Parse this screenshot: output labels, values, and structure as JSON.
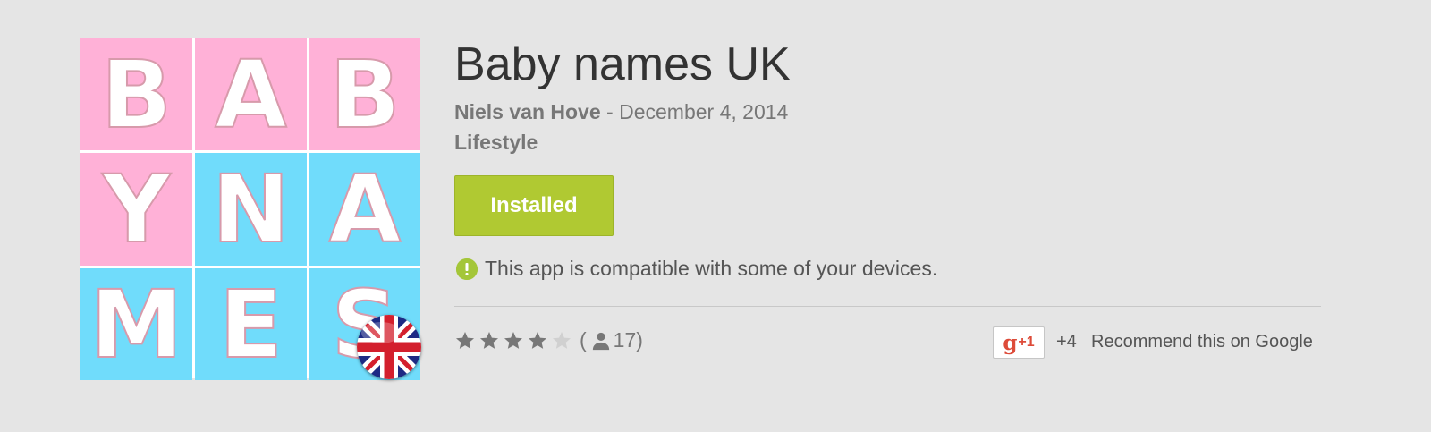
{
  "app_icon": {
    "tiles": [
      {
        "letter": "B",
        "color": "#ffb1d7"
      },
      {
        "letter": "A",
        "color": "#ffb1d7"
      },
      {
        "letter": "B",
        "color": "#ffb1d7"
      },
      {
        "letter": "Y",
        "color": "#ffb1d7"
      },
      {
        "letter": "N",
        "color": "#70dcfb"
      },
      {
        "letter": "A",
        "color": "#70dcfb"
      },
      {
        "letter": "M",
        "color": "#70dcfb"
      },
      {
        "letter": "E",
        "color": "#70dcfb"
      },
      {
        "letter": "S",
        "color": "#70dcfb"
      }
    ],
    "badge_icon": "uk-flag-icon"
  },
  "app": {
    "title": "Baby names UK",
    "developer": "Niels van Hove",
    "separator": " - ",
    "date": "December 4, 2014",
    "category": "Lifestyle"
  },
  "install_button": {
    "label": "Installed",
    "color": "#b0c932"
  },
  "compatibility": {
    "icon": "info-icon",
    "text": "This app is compatible with some of your devices."
  },
  "rating": {
    "stars_filled": 4,
    "stars_total": 5,
    "open_paren": "(",
    "count": "17",
    "close_paren": ")",
    "count_icon": "person-icon"
  },
  "social": {
    "gplus_button_g": "g",
    "gplus_button_plus": "+1",
    "plus_count": "+4",
    "recommend_text": "Recommend this on Google"
  }
}
